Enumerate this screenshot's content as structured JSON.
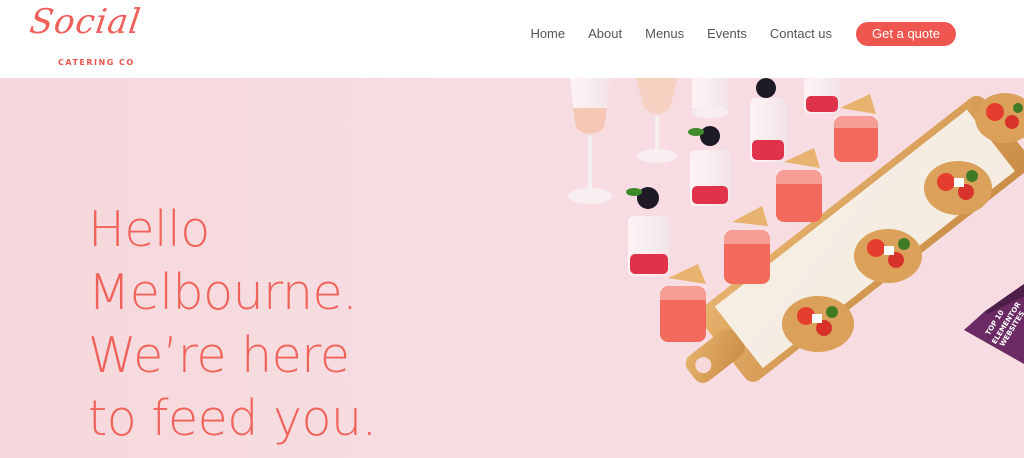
{
  "brand": {
    "script": "Social",
    "tagline": "CATERING CO",
    "color": "#f0605a"
  },
  "nav": {
    "items": [
      "Home",
      "About",
      "Menus",
      "Events",
      "Contact us"
    ],
    "cta": "Get a quote"
  },
  "hero": {
    "headline_lines": [
      "Hello",
      "Melbourne.",
      "We’re here",
      "to feed you."
    ],
    "background": "#f7dde1",
    "image_icon": "catering-food-photo"
  },
  "badge": {
    "rank": "TOP 10",
    "line1": "ELEMENTOR",
    "line2": "WEBSITES"
  }
}
